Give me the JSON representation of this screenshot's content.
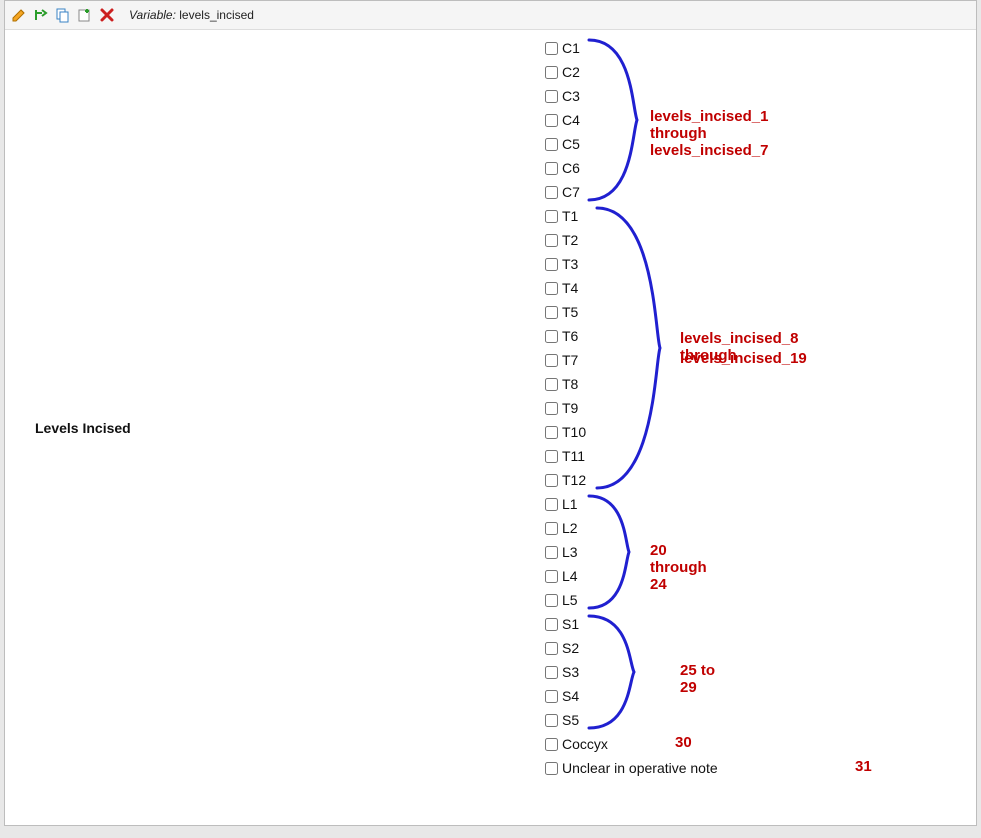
{
  "toolbar": {
    "variable_label": "Variable:",
    "variable_name": "levels_incised",
    "icons": {
      "edit": "pencil-icon",
      "branch": "branch-icon",
      "copy": "copy-icon",
      "plus": "plus-icon",
      "delete": "delete-icon"
    }
  },
  "field_label": "Levels Incised",
  "checkboxes": [
    {
      "label": "C1"
    },
    {
      "label": "C2"
    },
    {
      "label": "C3"
    },
    {
      "label": "C4"
    },
    {
      "label": "C5"
    },
    {
      "label": "C6"
    },
    {
      "label": "C7"
    },
    {
      "label": "T1"
    },
    {
      "label": "T2"
    },
    {
      "label": "T3"
    },
    {
      "label": "T4"
    },
    {
      "label": "T5"
    },
    {
      "label": "T6"
    },
    {
      "label": "T7"
    },
    {
      "label": "T8"
    },
    {
      "label": "T9"
    },
    {
      "label": "T10"
    },
    {
      "label": "T11"
    },
    {
      "label": "T12"
    },
    {
      "label": "L1"
    },
    {
      "label": "L2"
    },
    {
      "label": "L3"
    },
    {
      "label": "L4"
    },
    {
      "label": "L5"
    },
    {
      "label": "S1"
    },
    {
      "label": "S2"
    },
    {
      "label": "S3"
    },
    {
      "label": "S4"
    },
    {
      "label": "S5"
    },
    {
      "label": "Coccyx"
    },
    {
      "label": "Unclear in operative note"
    }
  ],
  "annotations": {
    "cervical": "levels_incised_1 through levels_incised_7",
    "thoracic_l1": "levels_incised_8 through",
    "thoracic_l2": "levels_incised_19",
    "lumbar": "20 through 24",
    "sacral": "25 to 29",
    "coccyx": "30",
    "unclear": "31"
  }
}
